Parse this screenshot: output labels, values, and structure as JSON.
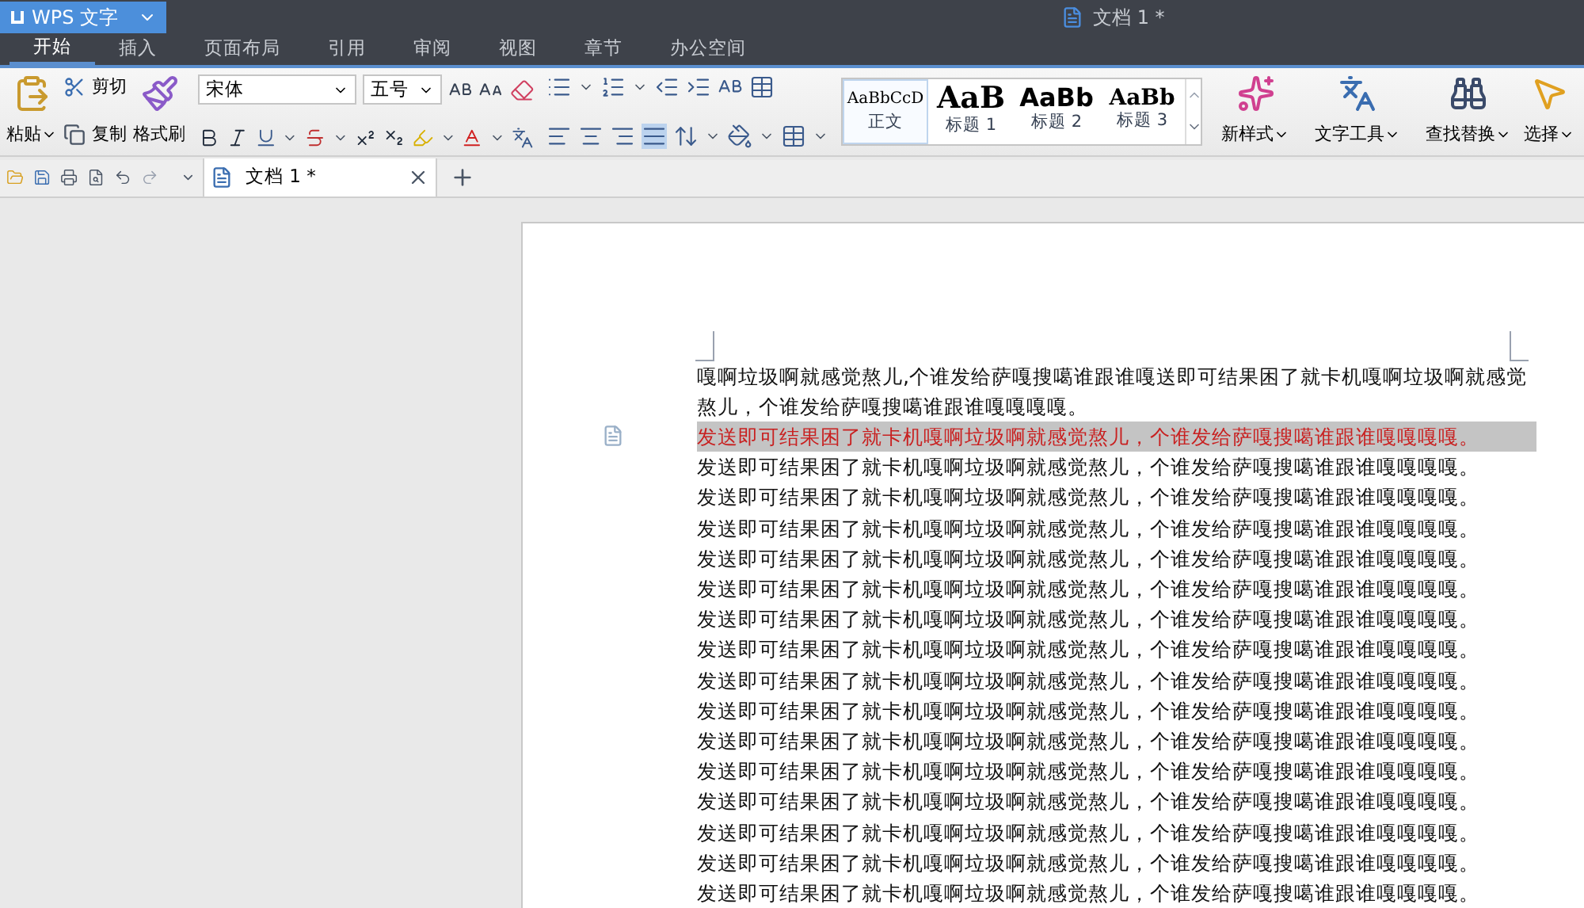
{
  "app_menu": {
    "label": "WPS 文字"
  },
  "window_title": "文档 1 *",
  "ribbon_tabs": [
    {
      "label": "开始",
      "selected": true
    },
    {
      "label": "插入",
      "selected": false
    },
    {
      "label": "页面布局",
      "selected": false
    },
    {
      "label": "引用",
      "selected": false
    },
    {
      "label": "审阅",
      "selected": false
    },
    {
      "label": "视图",
      "selected": false
    },
    {
      "label": "章节",
      "selected": false
    },
    {
      "label": "办公空间",
      "selected": false
    }
  ],
  "clipboard": {
    "paste": "粘贴",
    "cut": "剪切",
    "copy": "复制",
    "format_painter": "格式刷"
  },
  "font": {
    "family": "宋体",
    "size": "五号"
  },
  "styles": [
    {
      "preview": "AaBbCcD",
      "label": "正文",
      "selected": true
    },
    {
      "preview": "AaB",
      "label": "标题 1",
      "selected": false
    },
    {
      "preview": "AaBb",
      "label": "标题 2",
      "selected": false
    },
    {
      "preview": "AaBb",
      "label": "标题 3",
      "selected": false
    }
  ],
  "tools": [
    "新样式",
    "文字工具",
    "查找替换",
    "选择"
  ],
  "doc_tabs": [
    {
      "label": "文档 1 *",
      "selected": true
    }
  ],
  "paragraphs": [
    {
      "text": "嘎啊垃圾啊就感觉熬儿,个谁发给萨嘎搜噶谁跟谁嘎送即可结果困了就卡机嘎啊垃圾啊就感觉熬儿，个谁发给萨嘎搜噶谁跟谁嘎嘎嘎嘎。",
      "selected": false
    },
    {
      "text": "发送即可结果困了就卡机嘎啊垃圾啊就感觉熬儿，个谁发给萨嘎搜噶谁跟谁嘎嘎嘎嘎。",
      "selected": true
    },
    {
      "text": "发送即可结果困了就卡机嘎啊垃圾啊就感觉熬儿，个谁发给萨嘎搜噶谁跟谁嘎嘎嘎嘎。",
      "selected": false
    },
    {
      "text": "发送即可结果困了就卡机嘎啊垃圾啊就感觉熬儿，个谁发给萨嘎搜噶谁跟谁嘎嘎嘎嘎。",
      "selected": false
    },
    {
      "text": "发送即可结果困了就卡机嘎啊垃圾啊就感觉熬儿，个谁发给萨嘎搜噶谁跟谁嘎嘎嘎嘎。",
      "selected": false
    },
    {
      "text": "发送即可结果困了就卡机嘎啊垃圾啊就感觉熬儿，个谁发给萨嘎搜噶谁跟谁嘎嘎嘎嘎。",
      "selected": false
    },
    {
      "text": "发送即可结果困了就卡机嘎啊垃圾啊就感觉熬儿，个谁发给萨嘎搜噶谁跟谁嘎嘎嘎嘎。",
      "selected": false
    },
    {
      "text": "发送即可结果困了就卡机嘎啊垃圾啊就感觉熬儿，个谁发给萨嘎搜噶谁跟谁嘎嘎嘎嘎。",
      "selected": false
    },
    {
      "text": "发送即可结果困了就卡机嘎啊垃圾啊就感觉熬儿，个谁发给萨嘎搜噶谁跟谁嘎嘎嘎嘎。",
      "selected": false
    },
    {
      "text": "发送即可结果困了就卡机嘎啊垃圾啊就感觉熬儿，个谁发给萨嘎搜噶谁跟谁嘎嘎嘎嘎。",
      "selected": false
    },
    {
      "text": "发送即可结果困了就卡机嘎啊垃圾啊就感觉熬儿，个谁发给萨嘎搜噶谁跟谁嘎嘎嘎嘎。",
      "selected": false
    },
    {
      "text": "发送即可结果困了就卡机嘎啊垃圾啊就感觉熬儿，个谁发给萨嘎搜噶谁跟谁嘎嘎嘎嘎。",
      "selected": false
    },
    {
      "text": "发送即可结果困了就卡机嘎啊垃圾啊就感觉熬儿，个谁发给萨嘎搜噶谁跟谁嘎嘎嘎嘎。",
      "selected": false
    },
    {
      "text": "发送即可结果困了就卡机嘎啊垃圾啊就感觉熬儿，个谁发给萨嘎搜噶谁跟谁嘎嘎嘎嘎。",
      "selected": false
    },
    {
      "text": "发送即可结果困了就卡机嘎啊垃圾啊就感觉熬儿，个谁发给萨嘎搜噶谁跟谁嘎嘎嘎嘎。",
      "selected": false
    },
    {
      "text": "发送即可结果困了就卡机嘎啊垃圾啊就感觉熬儿，个谁发给萨嘎搜噶谁跟谁嘎嘎嘎嘎。",
      "selected": false
    },
    {
      "text": "发送即可结果困了就卡机嘎啊垃圾啊就感觉熬儿，个谁发给萨嘎搜噶谁跟谁嘎嘎嘎嘎。",
      "selected": false
    }
  ]
}
